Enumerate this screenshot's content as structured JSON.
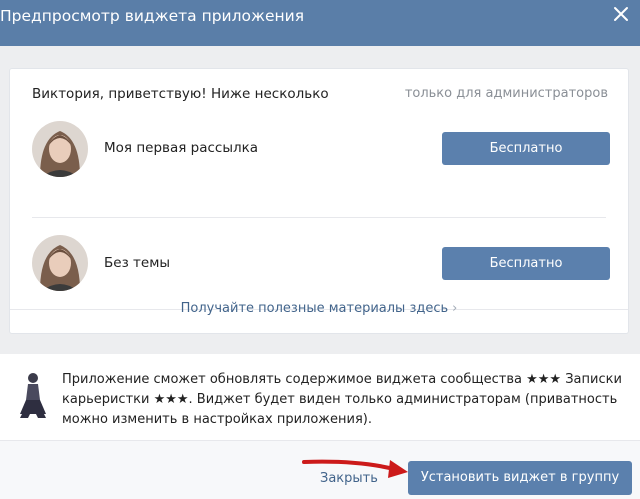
{
  "dialog": {
    "title": "Предпросмотр виджета приложения",
    "close_icon": "close-icon"
  },
  "widget": {
    "title": "Виктория, приветствую! Ниже несколько",
    "admin_note": "только для администраторов",
    "items": [
      {
        "title": "Моя первая рассылка",
        "button_label": "Бесплатно"
      },
      {
        "title": "Без темы",
        "button_label": "Бесплатно"
      }
    ],
    "footer_link": "Получайте полезные материалы здесь",
    "footer_chevron": "›"
  },
  "info": {
    "text": "Приложение сможет обновлять содержимое виджета сообщества ★★★ Записки карьеристки ★★★. Виджет будет виден только администраторам (приватность можно изменить в настройках приложения)."
  },
  "actions": {
    "close_label": "Закрыть",
    "install_label": "Установить виджет в группу"
  },
  "colors": {
    "header": "#5a7ea8",
    "button": "#5b80ad",
    "link": "#42648b",
    "arrow": "#cc1a1a"
  }
}
